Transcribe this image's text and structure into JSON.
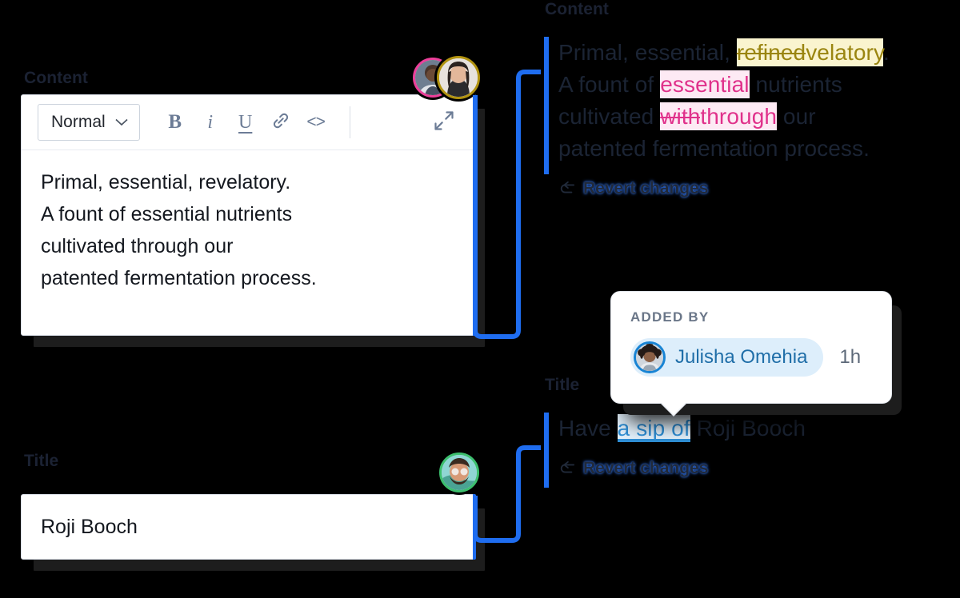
{
  "labels": {
    "content_left": "Content",
    "title_left": "Title",
    "content_right": "Content",
    "title_right": "Title"
  },
  "editor": {
    "toolbar": {
      "style_value": "Normal",
      "bold_label": "B",
      "italic_label": "i",
      "underline_label": "U",
      "code_label": "<>",
      "link_icon": "link-icon",
      "expand_icon": "expand-icon",
      "chevron_icon": "chevron-down-icon"
    },
    "body_text": "Primal, essential, revelatory.\nA fount of essential nutrients\ncultivated through our\npatented fermentation process."
  },
  "title_field": {
    "value": "Roji Booch"
  },
  "diff_content": {
    "line1_pre": "Primal, essential, ",
    "line1_del": "refined",
    "line1_ins": "velatory",
    "line1_post": ".",
    "line2_pre": "A fount of ",
    "line2_ins": "essential",
    "line2_post": " nutrients",
    "line3_pre": "cultivated ",
    "line3_del": "with",
    "line3_ins": "through",
    "line3_post": " our",
    "line4": "patented fermentation process.",
    "revert_label": "Revert changes",
    "revert_icon": "revert-arrow-icon"
  },
  "diff_title": {
    "pre": "Have ",
    "ins": "a sip of",
    "post": " Roji Booch",
    "revert_label": "Revert changes",
    "revert_icon": "revert-arrow-icon"
  },
  "tooltip": {
    "heading": "ADDED BY",
    "user_name": "Julisha Omehia",
    "time": "1h"
  },
  "colors": {
    "accent_blue": "#1f6df0",
    "insert_yellow_bg": "#faf4cf",
    "insert_yellow_fg": "#9a8510",
    "insert_pink_bg": "#fdeaf4",
    "insert_pink_fg": "#e0318b",
    "insert_blue_bg": "#e3f1fc",
    "insert_blue_fg": "#2f8fd6",
    "avatar_ring_pink": "#ec3f9a",
    "avatar_ring_gold": "#b29310",
    "avatar_ring_green": "#3cbf6e",
    "tooltip_pill_bg": "#ddeefb"
  }
}
